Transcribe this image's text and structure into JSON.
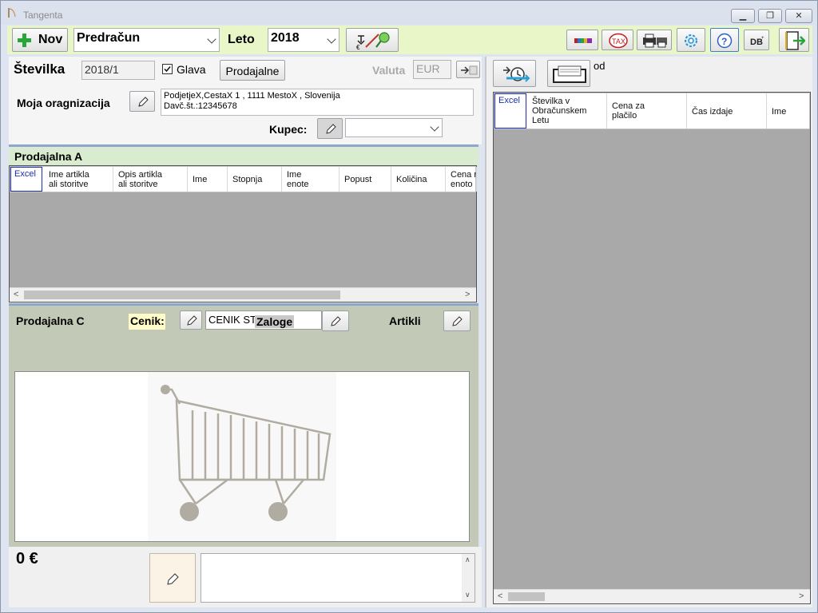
{
  "window": {
    "title": "Tangenta"
  },
  "toolbar": {
    "new_label": "Nov",
    "doc_type": "Predračun",
    "year_label": "Leto",
    "year": "2018"
  },
  "header": {
    "number_label": "Številka",
    "number": "2018/1",
    "head_checkbox_label": "Glava",
    "head_checked": true,
    "shops_button": "Prodajalne",
    "currency_label": "Valuta",
    "currency": "EUR",
    "org_label": "Moja oragnizacija",
    "org_line1": "PodjetjeX,CestaX 1 , 1111 MestoX , Slovenija",
    "org_line2": "Davč.št.:12345678",
    "buyer_label": "Kupec:",
    "buyer": ""
  },
  "shop_a": {
    "title": "Prodajalna A",
    "columns": [
      {
        "lines": [
          "Excel"
        ]
      },
      {
        "lines": [
          "Ime artikla",
          "ali storitve"
        ]
      },
      {
        "lines": [
          "Opis artikla",
          "ali storitve"
        ]
      },
      {
        "lines": [
          "Ime"
        ]
      },
      {
        "lines": [
          "Stopnja"
        ]
      },
      {
        "lines": [
          "Ime",
          "enote"
        ]
      },
      {
        "lines": [
          "Popust"
        ]
      },
      {
        "lines": [
          "Količina"
        ]
      },
      {
        "lines": [
          "Cena na",
          "enoto"
        ]
      }
    ]
  },
  "shop_c": {
    "title": "Prodajalna C",
    "pricelist_label": "Cenik:",
    "pricelist_value": "CENIK ST",
    "stock_label": "Zaloge",
    "items_label": "Artikli"
  },
  "footer": {
    "total": "0 €",
    "note": ""
  },
  "right": {
    "from_label": "od",
    "columns": [
      {
        "lines": [
          "Excel"
        ]
      },
      {
        "lines": [
          "Številka v",
          "Obračunskem",
          "Letu"
        ]
      },
      {
        "lines": [
          "Cena za",
          "plačilo"
        ]
      },
      {
        "lines": [
          "Čas izdaje"
        ]
      },
      {
        "lines": [
          "Ime"
        ]
      }
    ]
  },
  "colors": {
    "toolbar_bg": "#e8f6c8",
    "grid_gray": "#a9a9a9",
    "accent_green": "#2aa53a",
    "panel_c_bg": "#c3c9b7"
  }
}
